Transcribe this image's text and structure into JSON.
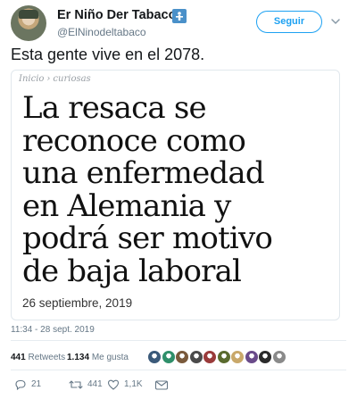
{
  "header": {
    "display_name": "Er Niño Der Tabaco",
    "name_icon": "cigarette-emoji-icon",
    "handle": "@ElNinodeltabaco",
    "follow_label": "Seguir",
    "menu_icon": "chevron-down-icon"
  },
  "tweet": {
    "text": "Esta gente vive en el 2078.",
    "timestamp": "11:34 - 28 sept. 2019"
  },
  "card": {
    "breadcrumb": [
      "Inicio",
      "curiosas"
    ],
    "breadcrumb_separator": "›",
    "headline_lines": [
      "La resaca se",
      "reconoce como",
      "una enfermedad",
      "en Alemania y",
      "podrá ser motivo",
      "de baja laboral"
    ],
    "date": "26 septiembre, 2019"
  },
  "stats": {
    "retweets_count": "441",
    "retweets_label": "Retweets",
    "likes_count": "1.134",
    "likes_label": "Me gusta",
    "liker_avatar_colors": [
      "#3b5a7a",
      "#2f8f6a",
      "#7a5a3c",
      "#4b4b4b",
      "#9a3b3b",
      "#5a6b2f",
      "#c9a86a",
      "#6a4b8a",
      "#2b2b2b",
      "#8a8a8a"
    ]
  },
  "actions": {
    "reply_count": "21",
    "retweet_count": "441",
    "like_count": "1,1K",
    "icons": [
      "reply-icon",
      "retweet-icon",
      "like-icon",
      "message-icon"
    ]
  },
  "colors": {
    "brand_blue": "#1da1f2",
    "secondary_text": "#657786",
    "border": "#e1e8ed"
  }
}
